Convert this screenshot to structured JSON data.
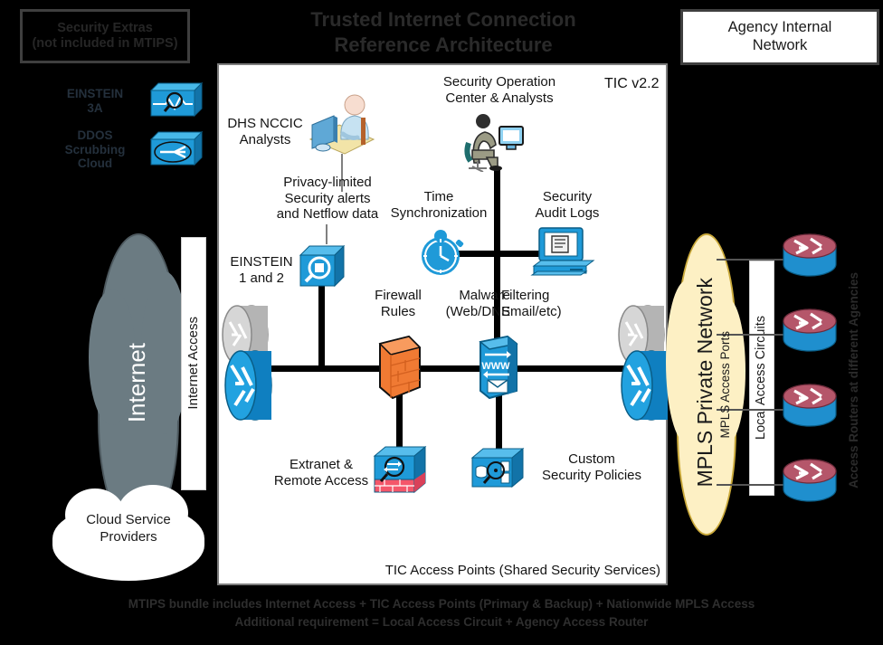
{
  "title": {
    "line1": "Trusted Internet Connection",
    "line2": "Reference Architecture",
    "version": "TIC v2.2"
  },
  "security_extras": {
    "header_line1": "Security Extras",
    "header_line2": "(not included in MTIPS)",
    "items": [
      {
        "label_line1": "EINSTEIN",
        "label_line2": "3A",
        "icon": "einstein-sensor-icon"
      },
      {
        "label_line1": "DDOS",
        "label_line2": "Scrubbing Cloud",
        "icon": "ddos-scrubbing-cloud-icon"
      }
    ]
  },
  "agency_box": {
    "line1": "Agency Internal",
    "line2": "Network"
  },
  "left": {
    "internet_cloud": "Internet",
    "internet_access_bar": "Internet Access",
    "cloud_service_providers_line1": "Cloud Service",
    "cloud_service_providers_line2": "Providers"
  },
  "right": {
    "mpls_cloud": "MPLS Private Network",
    "mpls_access_ports": "MPLS Access Ports",
    "local_access_circuits": "Local Access Circuits",
    "access_routers": "Access Routers at different Agencies",
    "router_count": 4
  },
  "tic_panel": {
    "footer_label": "TIC Access Points (Shared Security Services)",
    "nodes": [
      {
        "id": "dhs-nccic",
        "label_line1": "DHS NCCIC",
        "label_line2": "Analysts",
        "icon": "analyst-workstation-icon"
      },
      {
        "id": "privacy-data",
        "label_line1": "Privacy-limited",
        "label_line2": "Security alerts",
        "label_line3": "and Netflow data",
        "icon": ""
      },
      {
        "id": "einstein12",
        "label_line1": "EINSTEIN",
        "label_line2": "1 and 2",
        "icon": "einstein-sensor-box-icon"
      },
      {
        "id": "soc",
        "label_line1": "Security Operation",
        "label_line2": "Center & Analysts",
        "icon": "soc-analyst-icon"
      },
      {
        "id": "time-sync",
        "label_line1": "Time",
        "label_line2": "Synchronization",
        "icon": "stopwatch-icon"
      },
      {
        "id": "audit-logs",
        "label_line1": "Security",
        "label_line2": "Audit Logs",
        "icon": "log-monitor-icon"
      },
      {
        "id": "firewall",
        "label_line1": "Firewall",
        "label_line2": "Rules",
        "icon": "firewall-brick-icon"
      },
      {
        "id": "malware",
        "label_line1": "Malware",
        "label_line2": "(Web/DNS",
        "icon": ""
      },
      {
        "id": "filtering",
        "label_line1": "Filtering",
        "label_line2": "Email/etc)",
        "icon": "content-filter-icon"
      },
      {
        "id": "extranet",
        "label_line1": "Extranet &",
        "label_line2": "Remote Access",
        "icon": "vpn-firewall-icon"
      },
      {
        "id": "custom-policy",
        "label_line1": "Custom",
        "label_line2": "Security Policies",
        "icon": "policy-server-icon"
      }
    ]
  },
  "footer": {
    "line1": "MTIPS bundle includes Internet Access + TIC Access Points (Primary & Backup) + Nationwide MPLS Access",
    "line2": "Additional requirement = Local Access Circuit + Agency Access Router"
  },
  "colors": {
    "background": "#000000",
    "panel": "#ffffff",
    "internet_cloud": "#6b7b82",
    "mpls_cloud": "#fdf0c4",
    "router_blue": "#1b9ad6",
    "router_red": "#b5566a",
    "firewall_orange": "#f07a33",
    "device_blue": "#1f9ad8"
  }
}
